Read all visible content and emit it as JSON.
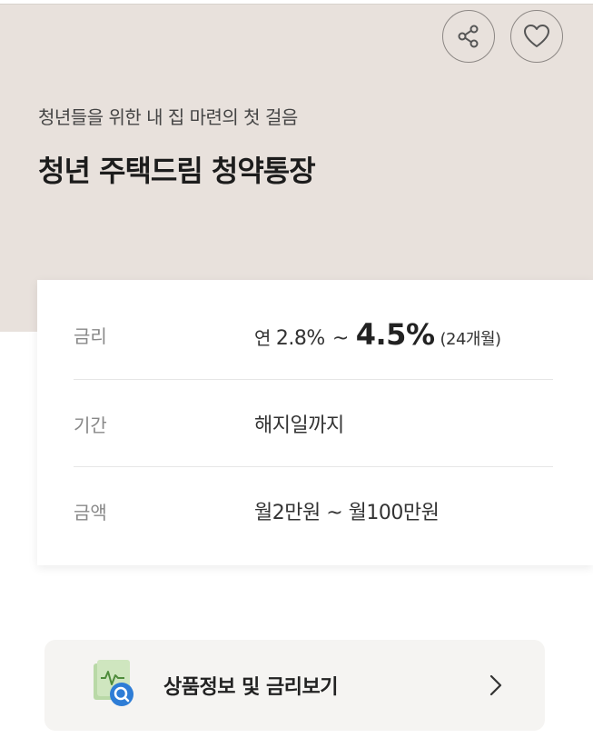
{
  "hero": {
    "subtitle": "청년들을 위한 내 집 마련의 첫 걸음",
    "title": "청년 주택드림 청약통장",
    "background_color": "#e8e1dc",
    "actions": [
      {
        "icon": "share-icon"
      },
      {
        "icon": "heart-icon"
      }
    ]
  },
  "details": {
    "rate": {
      "label": "금리",
      "prefix": "연",
      "min": "2.8%",
      "separator": "~",
      "max": "4.5%",
      "term": "(24개월)"
    },
    "period": {
      "label": "기간",
      "value": "해지일까지"
    },
    "amount": {
      "label": "금액",
      "value": "월2만원 ~ 월100만원"
    }
  },
  "info_button": {
    "label": "상품정보 및 금리보기",
    "icon": "document-search-icon",
    "trailing_icon": "chevron-right-icon"
  }
}
